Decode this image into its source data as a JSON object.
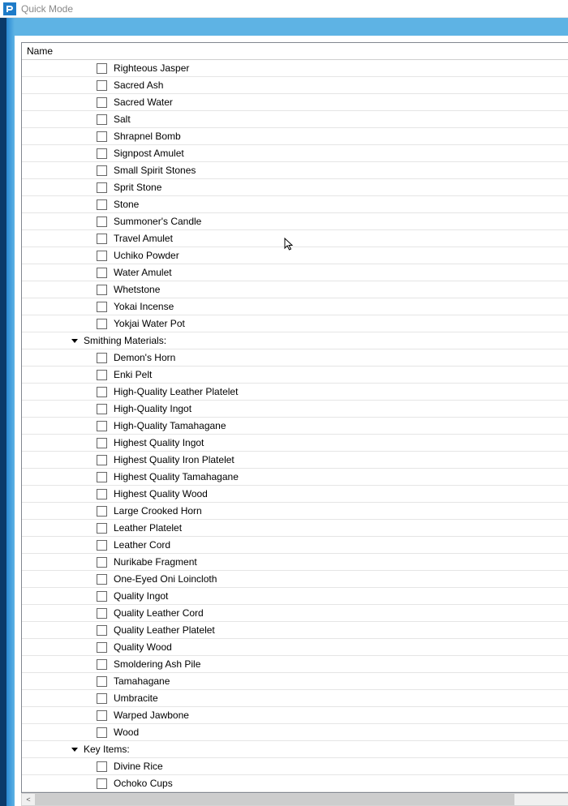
{
  "window": {
    "title": "Quick Mode"
  },
  "header": {
    "name": "Name"
  },
  "groups": [
    {
      "label": null,
      "items": [
        "Righteous Jasper",
        "Sacred Ash",
        "Sacred Water",
        "Salt",
        "Shrapnel Bomb",
        "Signpost Amulet",
        "Small Spirit Stones",
        "Sprit Stone",
        "Stone",
        "Summoner's Candle",
        "Travel Amulet",
        "Uchiko Powder",
        "Water Amulet",
        "Whetstone",
        "Yokai Incense",
        "Yokjai Water Pot"
      ]
    },
    {
      "label": "Smithing Materials:",
      "items": [
        "Demon's Horn",
        "Enki Pelt",
        "High-Quality Leather Platelet",
        "High-Quality Ingot",
        "High-Quality Tamahagane",
        "Highest Quality Ingot",
        "Highest Quality Iron Platelet",
        "Highest Quality Tamahagane",
        "Highest Quality Wood",
        "Large Crooked Horn",
        "Leather Platelet",
        "Leather Cord",
        "Nurikabe Fragment",
        "One-Eyed Oni Loincloth",
        "Quality Ingot",
        "Quality Leather Cord",
        "Quality Leather Platelet",
        "Quality Wood",
        "Smoldering Ash Pile",
        "Tamahagane",
        "Umbracite",
        "Warped Jawbone",
        "Wood"
      ]
    },
    {
      "label": "Key Items:",
      "items": [
        "Divine Rice",
        "Ochoko Cups"
      ]
    }
  ]
}
